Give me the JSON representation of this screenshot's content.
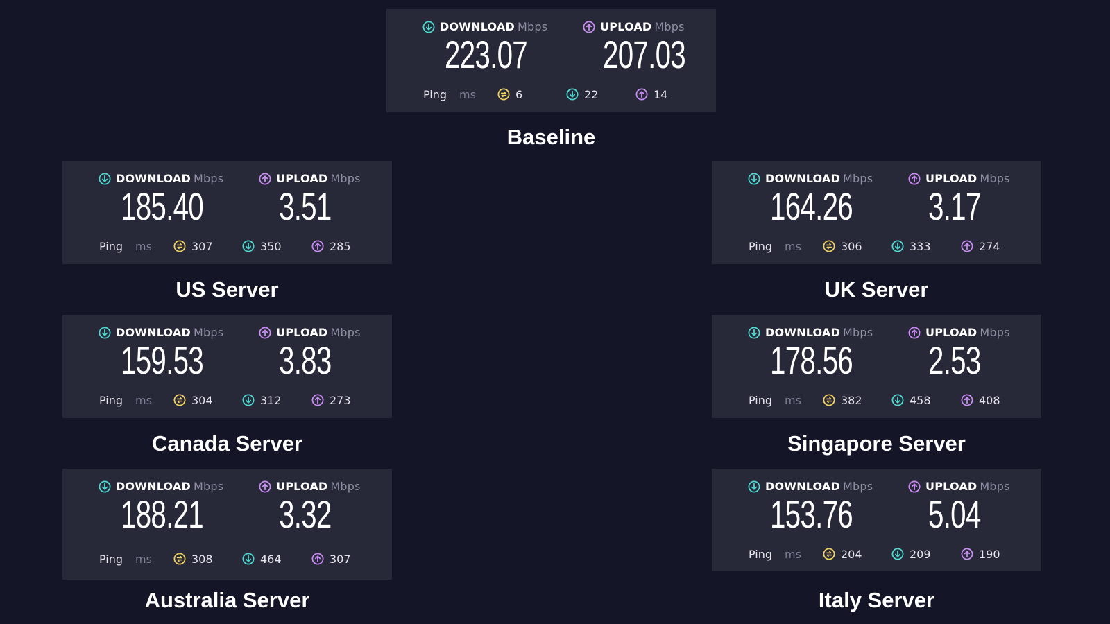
{
  "labels": {
    "download": "DOWNLOAD",
    "upload": "UPLOAD",
    "speed_unit": "Mbps",
    "ping": "Ping",
    "ping_unit": "ms"
  },
  "colors": {
    "background": "#141526",
    "card": "#272838",
    "download": "#4fd8d0",
    "upload": "#c88cf2",
    "idle": "#f0d060"
  },
  "icons": {
    "download": "arrow-down-circle-icon",
    "upload": "arrow-up-circle-icon",
    "idle": "idle-ping-icon"
  },
  "tests": [
    {
      "name": "Baseline",
      "download": "223.07",
      "upload": "207.03",
      "ping_idle": "6",
      "ping_download": "22",
      "ping_upload": "14"
    },
    {
      "name": "US Server",
      "download": "185.40",
      "upload": "3.51",
      "ping_idle": "307",
      "ping_download": "350",
      "ping_upload": "285"
    },
    {
      "name": "UK Server",
      "download": "164.26",
      "upload": "3.17",
      "ping_idle": "306",
      "ping_download": "333",
      "ping_upload": "274"
    },
    {
      "name": "Canada Server",
      "download": "159.53",
      "upload": "3.83",
      "ping_idle": "304",
      "ping_download": "312",
      "ping_upload": "273"
    },
    {
      "name": "Singapore Server",
      "download": "178.56",
      "upload": "2.53",
      "ping_idle": "382",
      "ping_download": "458",
      "ping_upload": "408"
    },
    {
      "name": "Australia Server",
      "download": "188.21",
      "upload": "3.32",
      "ping_idle": "308",
      "ping_download": "464",
      "ping_upload": "307"
    },
    {
      "name": "Italy Server",
      "download": "153.76",
      "upload": "5.04",
      "ping_idle": "204",
      "ping_download": "209",
      "ping_upload": "190"
    }
  ]
}
